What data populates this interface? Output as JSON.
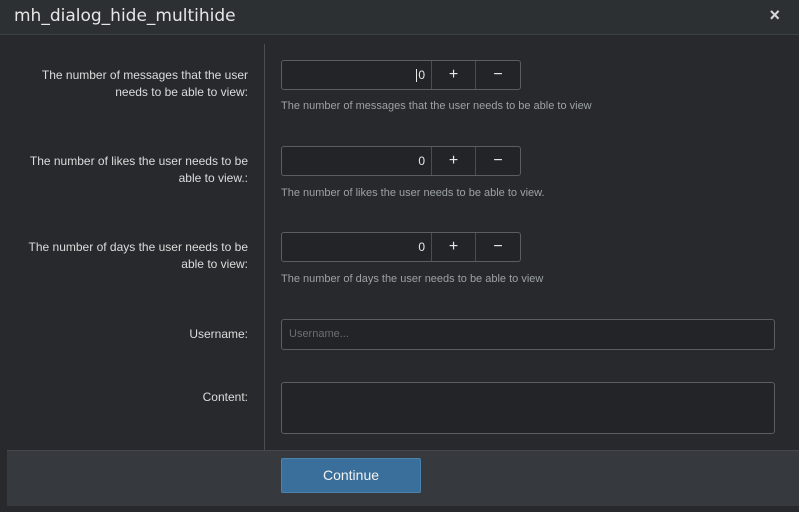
{
  "dialog": {
    "title": "mh_dialog_hide_multihide",
    "close_label": "×"
  },
  "fields": {
    "messages": {
      "label": "The number of messages that the user needs to be able to view:",
      "value": "0",
      "hint": "The number of messages that the user needs to be able to view",
      "plus": "+",
      "minus": "−"
    },
    "likes": {
      "label": "The number of likes the user needs to be able to view.:",
      "value": "0",
      "hint": "The number of likes the user needs to be able to view.",
      "plus": "+",
      "minus": "−"
    },
    "days": {
      "label": "The number of days the user needs to be able to view:",
      "value": "0",
      "hint": "The number of days the user needs to be able to view",
      "plus": "+",
      "minus": "−"
    },
    "username": {
      "label": "Username:",
      "placeholder": "Username..."
    },
    "content": {
      "label": "Content:"
    }
  },
  "footer": {
    "continue_label": "Continue"
  },
  "colors": {
    "accent": "#3a6f9b",
    "background": "#27292c"
  }
}
